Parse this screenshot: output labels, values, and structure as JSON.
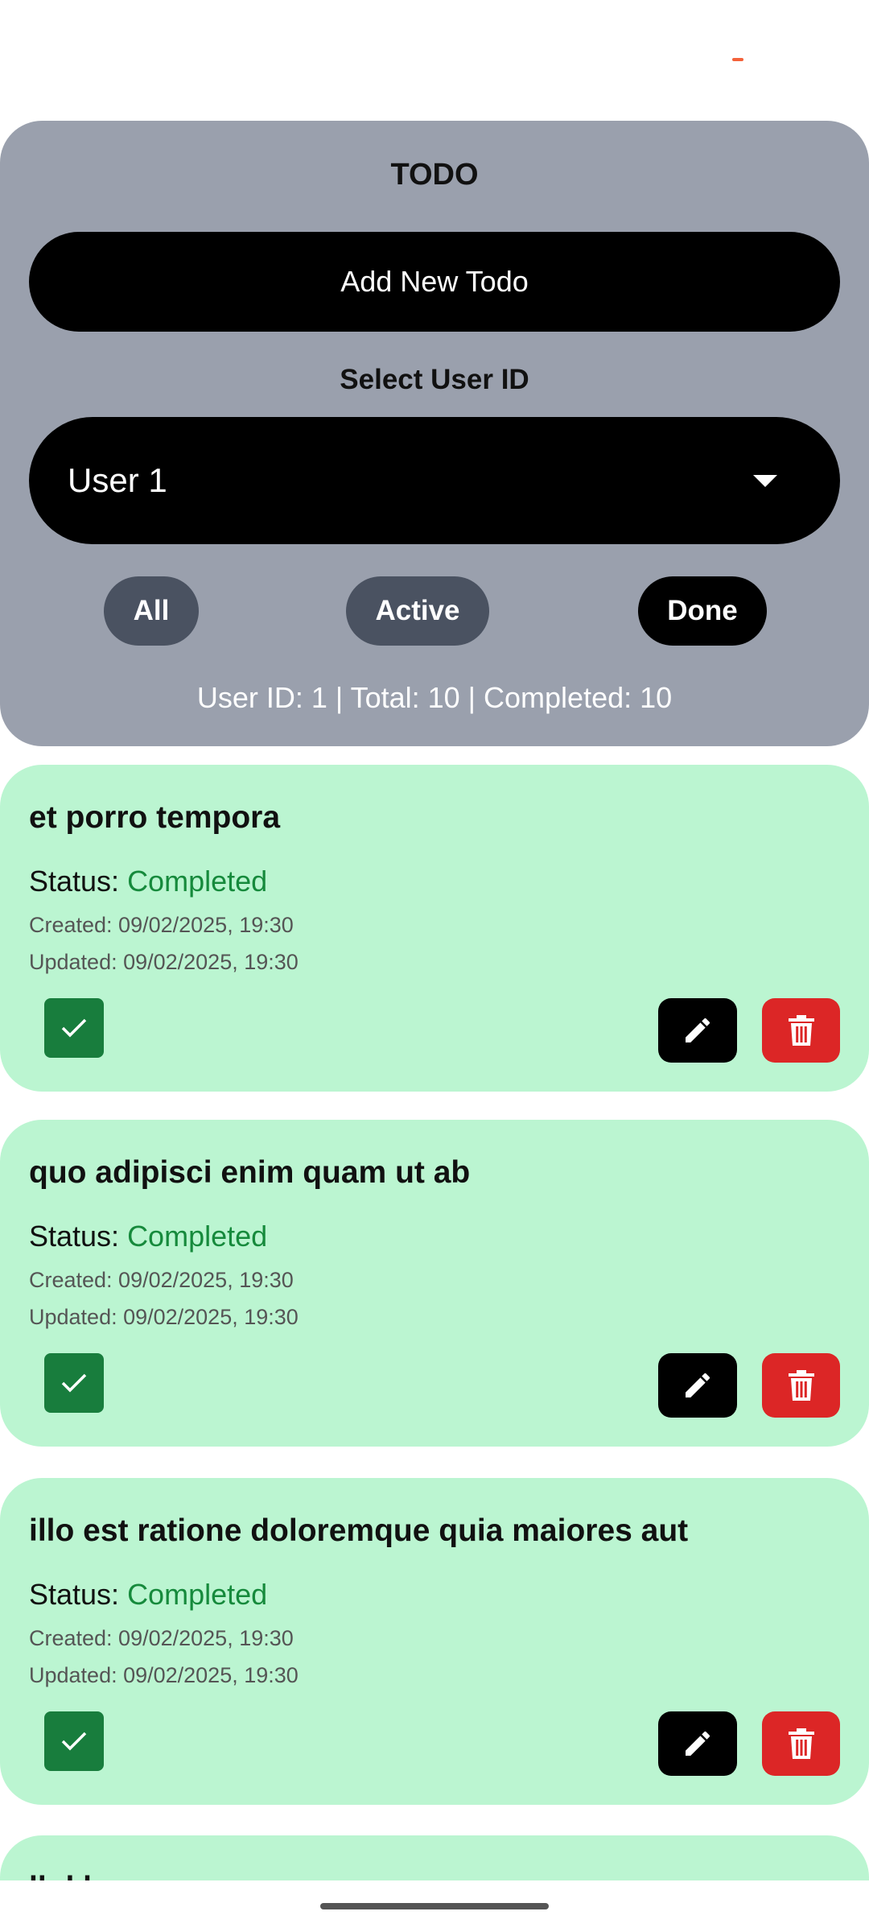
{
  "header": {
    "title": "TODO",
    "add_button": "Add New Todo",
    "select_label": "Select User ID",
    "selected_user": "User 1",
    "filters": {
      "all": "All",
      "active": "Active",
      "done": "Done"
    },
    "summary": "User ID: 1 | Total: 10 | Completed: 10"
  },
  "todos": [
    {
      "title": "et porro tempora",
      "status_label": "Status: ",
      "status_value": "Completed",
      "created": "Created: 09/02/2025, 19:30",
      "updated": "Updated: 09/02/2025, 19:30",
      "completed": true
    },
    {
      "title": "quo adipisci enim quam ut ab",
      "status_label": "Status: ",
      "status_value": "Completed",
      "created": "Created: 09/02/2025, 19:30",
      "updated": "Updated: 09/02/2025, 19:30",
      "completed": true
    },
    {
      "title": "illo est ratione doloremque quia maiores aut",
      "status_label": "Status: ",
      "status_value": "Completed",
      "created": "Created: 09/02/2025, 19:30",
      "updated": "Updated: 09/02/2025, 19:30",
      "completed": true
    }
  ],
  "partial_card_title": "ll d l",
  "icons": {
    "check": "check-icon",
    "edit": "pencil-icon",
    "delete": "trash-icon",
    "dropdown": "caret-down-icon"
  },
  "colors": {
    "header_bg": "#9aa0ad",
    "card_bg": "#bbf5d1",
    "status_completed": "#168a3c",
    "checkbox": "#187d3d",
    "delete": "#dc2626",
    "filter_inactive": "#4a5261"
  }
}
